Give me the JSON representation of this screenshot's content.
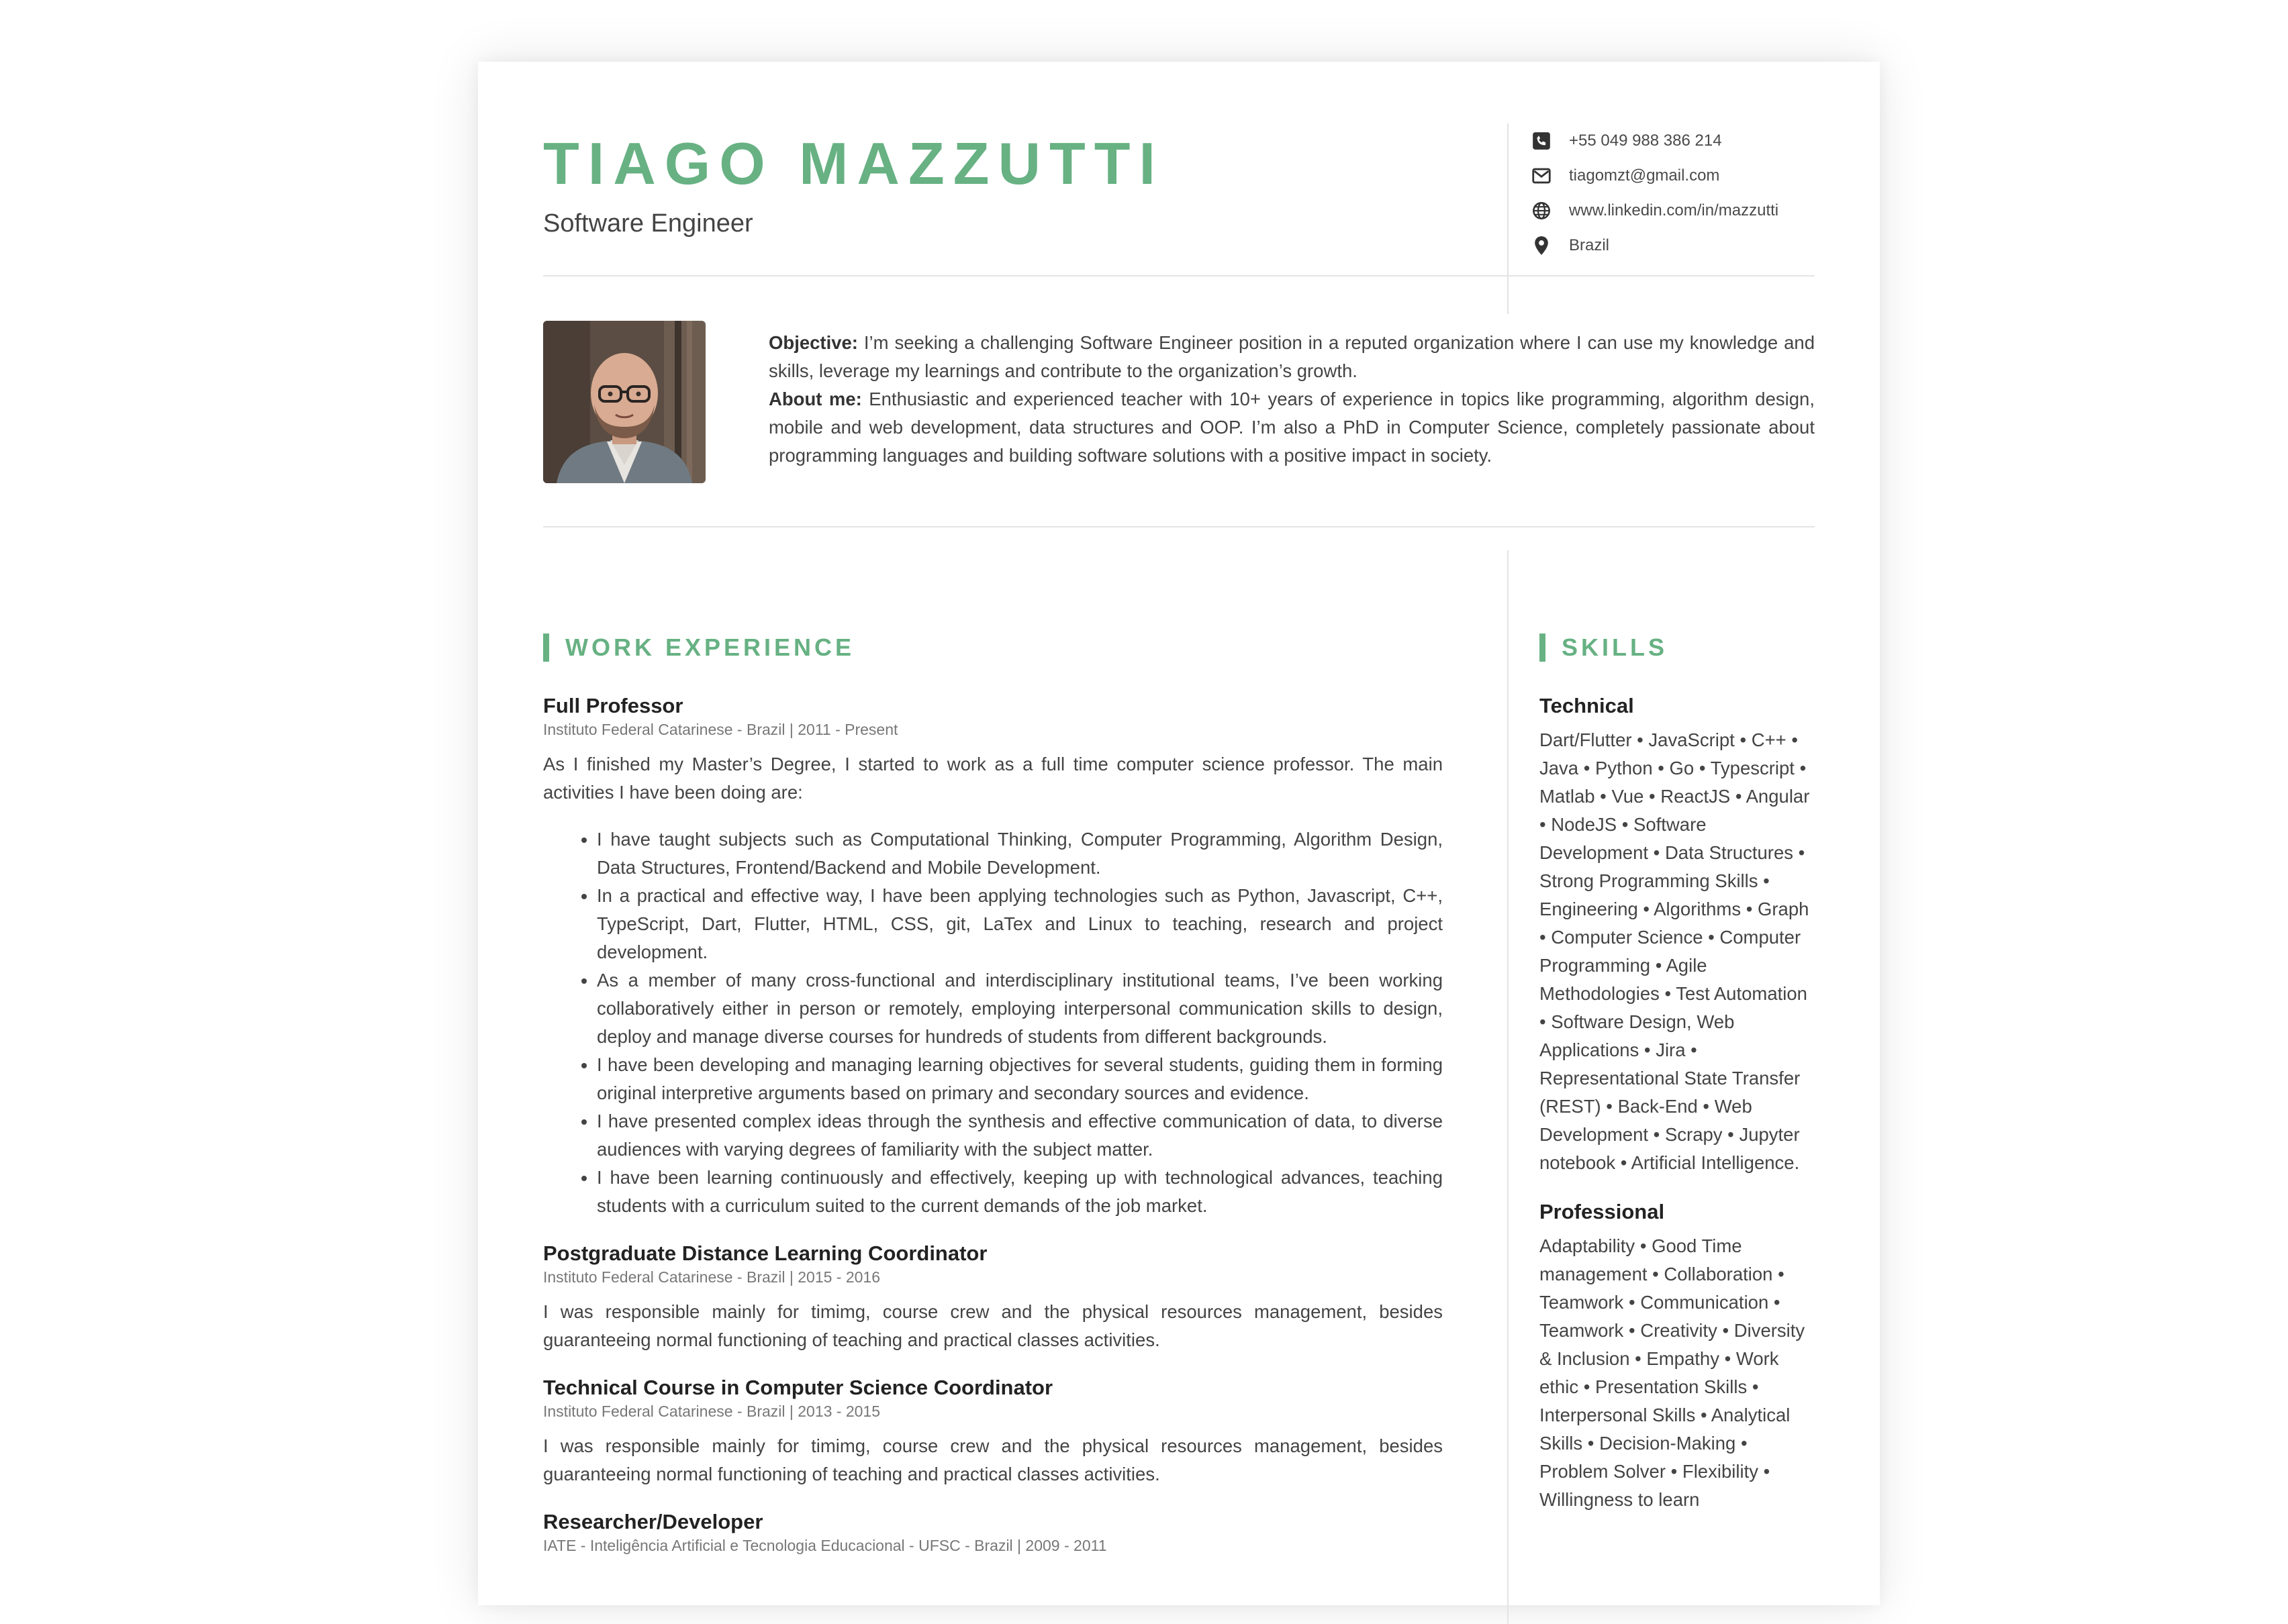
{
  "header": {
    "name": "TIAGO MAZZUTTI",
    "title": "Software Engineer",
    "contacts": [
      {
        "icon": "phone-icon",
        "text": "+55 049 988 386 214"
      },
      {
        "icon": "envelope-icon",
        "text": "tiagomzt@gmail.com"
      },
      {
        "icon": "globe-icon",
        "text": "www.linkedin.com/in/mazzutti"
      },
      {
        "icon": "location-pin-icon",
        "text": "Brazil"
      }
    ]
  },
  "profile": {
    "objective_label": "Objective:",
    "objective": " I’m seeking a challenging Software Engineer position in a reputed organization where I can use my knowledge and skills, leverage my learnings and contribute to the organization’s growth.",
    "about_label": "About me:",
    "about": " Enthusiastic and experienced teacher with 10+ years of experience in topics like programming, algorithm design, mobile and web development, data structures and OOP. I’m also a PhD in Computer Science, completely passionate about programming languages and building software solutions with a positive impact in society."
  },
  "work": {
    "heading": "WORK EXPERIENCE",
    "jobs": [
      {
        "title": "Full Professor",
        "meta": "Instituto Federal Catarinese - Brazil | 2011 - Present",
        "desc": "As I finished my Master’s Degree, I started to work as a full time computer science professor. The main activities I have been doing are:",
        "bullets": [
          "I have taught subjects such as Computational Thinking, Computer Programming, Algorithm Design, Data Structures, Frontend/Backend and Mobile Development.",
          "In a practical and effective way, I have been applying technologies such as Python, Javascript, C++, TypeScript, Dart, Flutter, HTML, CSS, git, LaTex and Linux to teaching, research and project development.",
          "As a member of many cross-functional and interdisciplinary institutional teams, I’ve been working collaboratively either in person or remotely, employing interpersonal communication skills to design, deploy and manage diverse courses for hundreds of students from different backgrounds.",
          "I have been developing and managing learning objectives for several students, guiding them in forming original interpretive arguments based on primary and secondary sources and evidence.",
          "I have presented complex ideas through the synthesis and effective communication of data, to diverse audiences with varying degrees of familiarity with the subject matter.",
          "I have been learning continuously and effectively, keeping up with technological advances, teaching students with a curriculum suited to the current demands of the job market."
        ]
      },
      {
        "title": "Postgraduate Distance Learning Coordinator",
        "meta": "Instituto Federal Catarinese - Brazil | 2015 - 2016",
        "desc": "I was responsible mainly for timimg, course crew and the physical resources management, besides guaranteeing normal functioning of teaching and practical classes activities."
      },
      {
        "title": "Technical Course in Computer Science Coordinator",
        "meta": "Instituto Federal Catarinese - Brazil | 2013 - 2015",
        "desc": "I was responsible mainly for timimg, course crew and the physical resources management, besides guaranteeing normal functioning of teaching and practical classes activities."
      },
      {
        "title": "Researcher/Developer",
        "meta": "IATE - Inteligência Artificial e Tecnologia Educacional - UFSC - Brazil | 2009 - 2011",
        "desc": ""
      }
    ]
  },
  "skills": {
    "heading": "SKILLS",
    "technical_label": "Technical",
    "technical": "Dart/Flutter • JavaScript • C++ • Java • Python • Go • Typescript • Matlab • Vue • ReactJS • Angular • NodeJS • Software Development • Data Structures • Strong Programming Skills • Engineering • Algorithms • Graph • Computer Science • Computer Programming • Agile Methodologies • Test Automation • Software Design, Web Applications • Jira • Representational State Transfer (REST) • Back-End • Web Development • Scrapy • Jupyter notebook • Artificial Intelligence.",
    "professional_label": "Professional",
    "professional": "Adaptability • Good Time management • Collaboration • Teamwork • Communication • Teamwork • Creativity • Diversity & Inclusion • Empathy • Work ethic • Presentation Skills • Interpersonal Skills • Analytical Skills • Decision-Making • Problem Solver • Flexibility • Willingness to learn"
  },
  "colors": {
    "accent": "#67b183",
    "text": "#444444",
    "heading": "#222222"
  }
}
